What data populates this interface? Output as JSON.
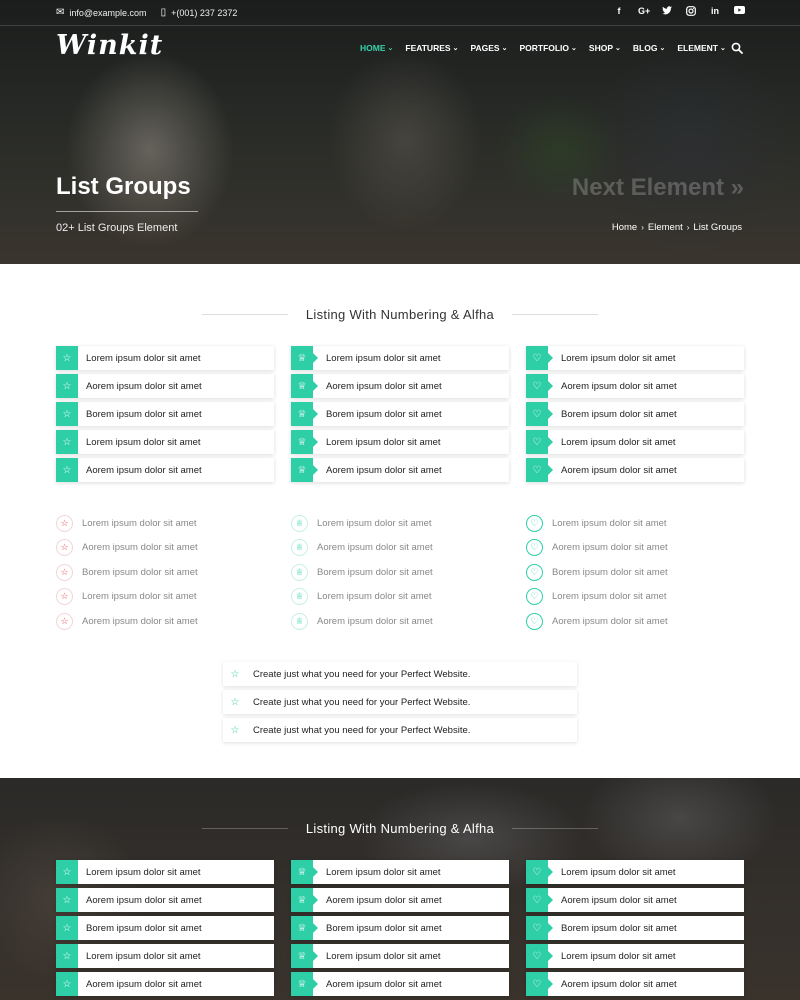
{
  "topbar": {
    "email": "info@example.com",
    "phone": "+(001) 237 2372",
    "email_icon": "envelope-icon",
    "phone_icon": "phone-icon",
    "social": [
      "f",
      "G+",
      "t",
      "ig",
      "in",
      "yt"
    ]
  },
  "brand": {
    "logo": "Winkit"
  },
  "nav": {
    "items": [
      "HOME",
      "FEATURES",
      "PAGES",
      "PORTFOLIO",
      "SHOP",
      "BLOG",
      "ELEMENT"
    ],
    "active": "HOME",
    "accent_color": "#3ad1a9"
  },
  "hero": {
    "title": "List Groups",
    "subtitle": "02+ List Groups Element",
    "next_link": "Next Element »",
    "breadcrumb": [
      "Home",
      "Element",
      "List Groups"
    ]
  },
  "section1": {
    "heading": "Listing With Numbering & Alfha",
    "col1": [
      "Lorem ipsum dolor sit amet",
      "Aorem ipsum dolor sit amet",
      "Borem ipsum dolor sit amet",
      "Lorem ipsum dolor sit amet",
      "Aorem ipsum dolor sit amet"
    ],
    "col2": [
      "Lorem ipsum dolor sit amet",
      "Aorem ipsum dolor sit amet",
      "Borem ipsum dolor sit amet",
      "Lorem ipsum dolor sit amet",
      "Aorem ipsum dolor sit amet"
    ],
    "col3": [
      "Lorem ipsum dolor sit amet",
      "Aorem ipsum dolor sit amet",
      "Borem ipsum dolor sit amet",
      "Lorem ipsum dolor sit amet",
      "Aorem ipsum dolor sit amet"
    ],
    "col1_icon": "star-icon",
    "col2_icon": "trophy-icon",
    "col3_icon": "heart-icon",
    "box_color": "#2ecfa6"
  },
  "section2": {
    "col1": [
      "Lorem ipsum dolor sit amet",
      "Aorem ipsum dolor sit amet",
      "Borem ipsum dolor sit amet",
      "Lorem ipsum dolor sit amet",
      "Aorem ipsum dolor sit amet"
    ],
    "col2": [
      "Lorem ipsum dolor sit amet",
      "Aorem ipsum dolor sit amet",
      "Borem ipsum dolor sit amet",
      "Lorem ipsum dolor sit amet",
      "Aorem ipsum dolor sit amet"
    ],
    "col3": [
      "Lorem ipsum dolor sit amet",
      "Aorem ipsum dolor sit amet",
      "Borem ipsum dolor sit amet",
      "Lorem ipsum dolor sit amet",
      "Aorem ipsum dolor sit amet"
    ]
  },
  "section3": {
    "items": [
      "Create just what you need for your Perfect Website.",
      "Create just what you need for your Perfect Website.",
      "Create just what you need for your Perfect Website."
    ]
  },
  "section4": {
    "heading": "Listing With Numbering & Alfha",
    "col1": [
      "Lorem ipsum dolor sit amet",
      "Aorem ipsum dolor sit amet",
      "Borem ipsum dolor sit amet",
      "Lorem ipsum dolor sit amet",
      "Aorem ipsum dolor sit amet"
    ],
    "col2": [
      "Lorem ipsum dolor sit amet",
      "Aorem ipsum dolor sit amet",
      "Borem ipsum dolor sit amet",
      "Lorem ipsum dolor sit amet",
      "Aorem ipsum dolor sit amet"
    ],
    "col3": [
      "Lorem ipsum dolor sit amet",
      "Aorem ipsum dolor sit amet",
      "Borem ipsum dolor sit amet",
      "Lorem ipsum dolor sit amet",
      "Aorem ipsum dolor sit amet"
    ]
  }
}
